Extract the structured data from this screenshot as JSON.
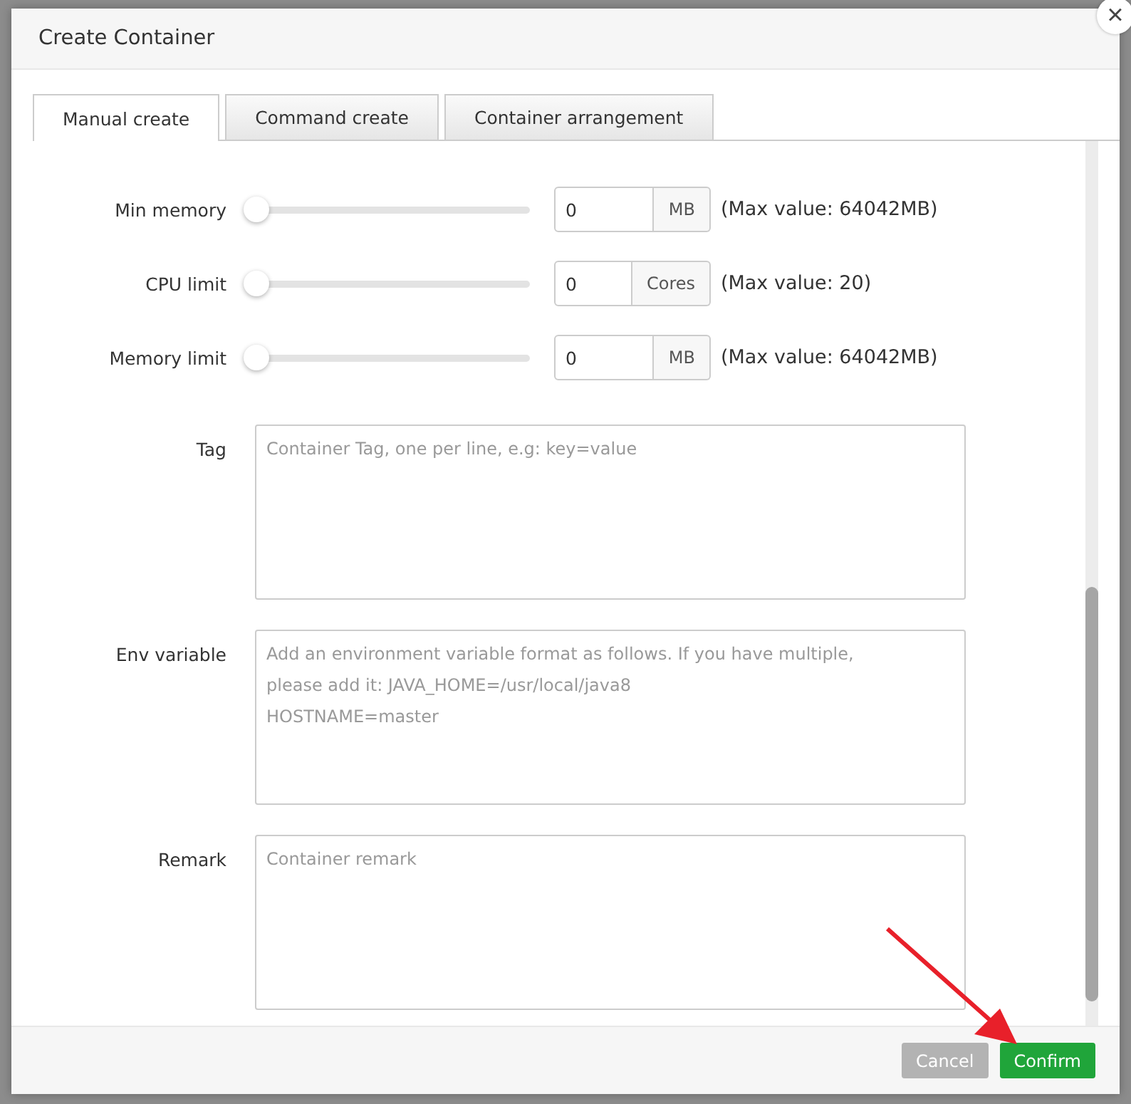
{
  "dialog": {
    "title": "Create Container",
    "close": "×"
  },
  "tabs": [
    {
      "label": "Manual create",
      "selected": true
    },
    {
      "label": "Command create",
      "selected": false
    },
    {
      "label": "Container arrangement",
      "selected": false
    }
  ],
  "limits": [
    {
      "label": "Min memory",
      "level": 0,
      "value": "0",
      "unit": "MB",
      "note": "(Max value: 64042MB)"
    },
    {
      "label": "CPU limit",
      "level": 0,
      "value": "0",
      "unit": "Cores",
      "note": "(Max value: 20)"
    },
    {
      "label": "Memory limit",
      "level": 0,
      "value": "0",
      "unit": "MB",
      "note": "(Max value: 64042MB)"
    }
  ],
  "text_fields": [
    {
      "label": "Tag",
      "placeholder": "Container Tag, one per line, e.g: key=value"
    },
    {
      "label": "Env variable",
      "placeholder": "Add an environment variable format as follows. If you have multiple,\nplease add it: JAVA_HOME=/usr/local/java8\nHOSTNAME=master"
    },
    {
      "label": "Remark",
      "placeholder": "Container remark"
    }
  ],
  "buttons": [
    {
      "label": "Cancel",
      "kind": "secondary",
      "disabled": true
    },
    {
      "label": "Confirm",
      "kind": "primary",
      "disabled": false
    }
  ]
}
